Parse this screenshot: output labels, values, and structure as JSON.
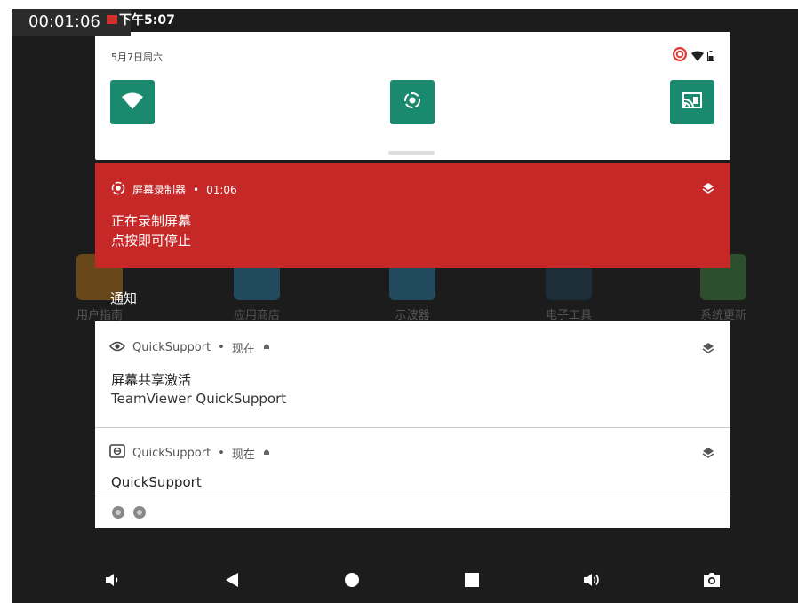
{
  "recording_timer": "00:01:06",
  "status_bar": {
    "time": "下午5:07"
  },
  "quick_settings": {
    "date": "5月7日周六",
    "tiles": [
      {
        "name": "wifi-tile",
        "icon": "wifi-icon"
      },
      {
        "name": "screen-record-tile",
        "icon": "screen-record-icon"
      },
      {
        "name": "cast-tile",
        "icon": "cast-icon"
      }
    ],
    "status_icons": [
      "screen-record-icon",
      "wifi-icon",
      "battery-icon"
    ]
  },
  "recorder_notification": {
    "app": "屏幕录制器",
    "elapsed": "01:06",
    "line1": "正在录制屏幕",
    "line2": "点按即可停止",
    "color": "#c62828"
  },
  "section_label": "通知",
  "notifications": [
    {
      "app": "QuickSupport",
      "time": "现在",
      "title": "屏幕共享激活",
      "text": "TeamViewer QuickSupport"
    },
    {
      "app": "QuickSupport",
      "time": "现在",
      "title": "QuickSupport",
      "text": ""
    }
  ],
  "background_apps": [
    {
      "label": "用户指南",
      "color": "#f59b19"
    },
    {
      "label": "应用商店",
      "color": "#2aa1dc"
    },
    {
      "label": "示波器",
      "color": "#2aa1dc"
    },
    {
      "label": "电子工具",
      "color": "#1f4f6e"
    },
    {
      "label": "系统更新",
      "color": "#4caf50"
    }
  ],
  "nav_bar": [
    "volume-down-icon",
    "back-icon",
    "home-icon",
    "recents-icon",
    "volume-up-icon",
    "screenshot-icon"
  ],
  "accent_color": "#1a8a6e"
}
